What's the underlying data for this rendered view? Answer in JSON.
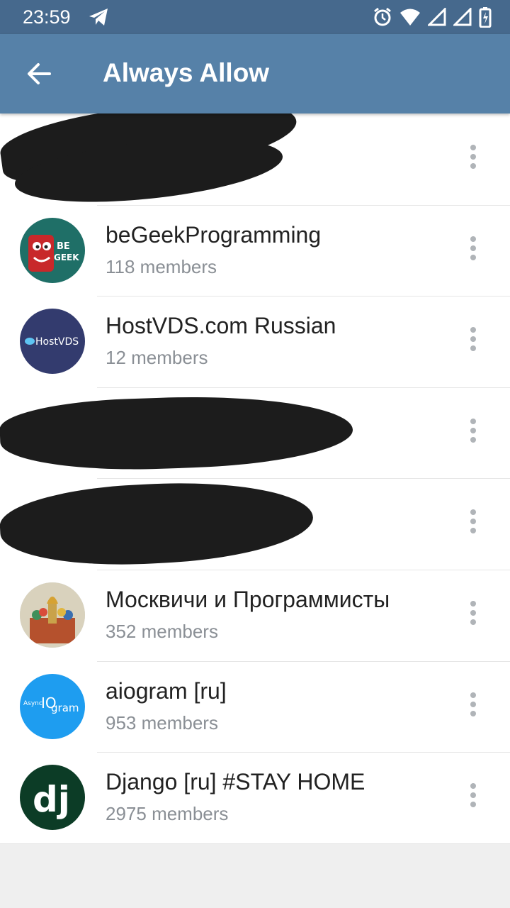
{
  "status": {
    "time": "23:59"
  },
  "header": {
    "title": "Always Allow"
  },
  "chats": [
    {
      "name": "",
      "members": "",
      "redacted": true
    },
    {
      "name": "beGeekProgramming",
      "members": "118 members",
      "avatar_text": "BE GEEK",
      "avatar_color": "#1f6f67"
    },
    {
      "name": "HostVDS.com Russian",
      "members": "12 members",
      "avatar_text": "HostVDS",
      "avatar_color": "#333b6e"
    },
    {
      "name": "",
      "members": "",
      "redacted": true
    },
    {
      "name": "",
      "members": "",
      "redacted": true
    },
    {
      "name": "Москвичи и Программисты",
      "members": "352 members",
      "avatar_color": "#c9b48a"
    },
    {
      "name": "aiogram [ru]",
      "members": "953 members",
      "avatar_text": "Async IO gram",
      "avatar_color": "#1e9df0"
    },
    {
      "name": "Django [ru] #STAY HOME",
      "members": "2975 members",
      "avatar_text": "dj",
      "avatar_color": "#0c3c26"
    }
  ],
  "colors": {
    "statusbar": "#46698d",
    "appbar": "#5681a8",
    "subtitle": "#8a8f95"
  }
}
